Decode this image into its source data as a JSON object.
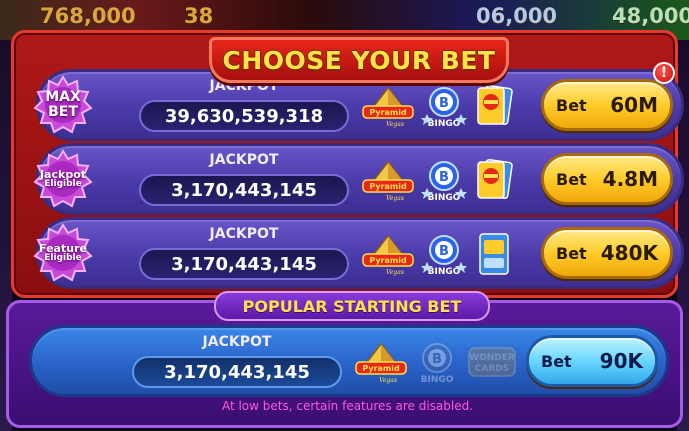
{
  "background": {
    "numbers": [
      "768,000",
      "38",
      "06,000",
      "48,000"
    ]
  },
  "header": {
    "title": "CHOOSE YOUR BET"
  },
  "rows": [
    {
      "badge": {
        "line1": "MAX",
        "line2": "BET",
        "icon": "max-bet-badge"
      },
      "jackpot_label": "JACKPOT",
      "jackpot_value": "39,630,539,318",
      "features": {
        "pyramid": "pyramid-vegas-icon",
        "bingo": "bingo-icon",
        "card": "feature-card-icon",
        "bingo_active": true
      },
      "bet_word": "Bet",
      "bet_amount": "60M",
      "alert": "!"
    },
    {
      "badge": {
        "line1": "Jackpot",
        "line2": "Eligible",
        "icon": "jackpot-eligible-badge"
      },
      "jackpot_label": "JACKPOT",
      "jackpot_value": "3,170,443,145",
      "features": {
        "pyramid": "pyramid-vegas-icon",
        "bingo": "bingo-icon",
        "card": "feature-card-icon",
        "bingo_active": true
      },
      "bet_word": "Bet",
      "bet_amount": "4.8M"
    },
    {
      "badge": {
        "line1": "Feature",
        "line2": "Eligible",
        "icon": "feature-eligible-badge"
      },
      "jackpot_label": "JACKPOT",
      "jackpot_value": "3,170,443,145",
      "features": {
        "pyramid": "pyramid-vegas-icon",
        "bingo": "bingo-icon",
        "card": "scratch-card-icon",
        "bingo_active": true
      },
      "bet_word": "Bet",
      "bet_amount": "480K"
    }
  ],
  "popular": {
    "title": "POPULAR STARTING BET",
    "row": {
      "jackpot_label": "JACKPOT",
      "jackpot_value": "3,170,443,145",
      "features": {
        "pyramid": "pyramid-vegas-icon",
        "bingo": "bingo-icon",
        "card": "wonder-cards-icon",
        "bingo_active": false
      },
      "bet_word": "Bet",
      "bet_amount": "90K"
    },
    "disclaimer": "At low bets, certain features are disabled."
  },
  "icon_labels": {
    "pyramid": "Pyramid",
    "pyramid_sub": "Vegas",
    "bingo": "BINGO",
    "wonder": "WONDER",
    "wonder_sub": "CARDS"
  },
  "colors": {
    "title_yellow": "#ffe14a",
    "panel_red": "#b01818",
    "row_purple": "#5544b8",
    "row_blue": "#2a62c8",
    "bet_gold": "#ffcc2a",
    "bet_cyan": "#6ad6ff",
    "badge_magenta": "#c84ad8",
    "disclaimer_pink": "#ff5ad8"
  }
}
